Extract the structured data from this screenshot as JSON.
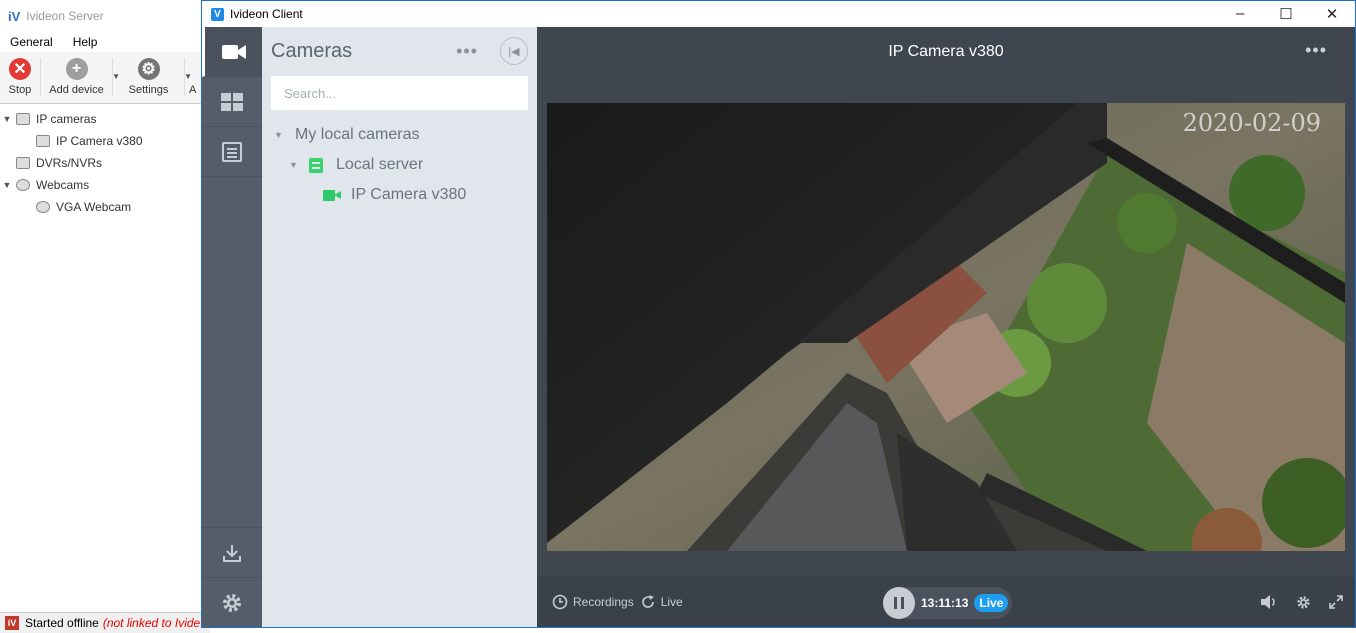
{
  "server": {
    "title": "Ivideon Server",
    "menu": [
      "General",
      "Help"
    ],
    "toolbar": {
      "stop": "Stop",
      "add_device": "Add device",
      "settings": "Settings",
      "cut": "A"
    },
    "tree": {
      "ip_cameras": "IP cameras",
      "ip_camera_v380": "IP Camera v380",
      "dvrs": "DVRs/NVRs",
      "webcams": "Webcams",
      "vga_webcam": "VGA Webcam"
    },
    "status": {
      "text": "Started offline",
      "note": "(not linked to Ivide"
    }
  },
  "client": {
    "title": "Ivideon Client",
    "panel": {
      "title": "Cameras",
      "search_placeholder": "Search...",
      "group": "My local cameras",
      "server": "Local server",
      "camera": "IP Camera v380"
    },
    "viewer": {
      "title": "IP Camera v380",
      "overlay_timestamp": "2020-02-09",
      "recordings_label": "Recordings",
      "live_label": "Live",
      "time": "13:11:13",
      "live_badge": "Live"
    }
  },
  "colors": {
    "accent": "#1e9ef0",
    "online": "#2ec968",
    "rail": "#545d69",
    "panel": "#e1e5ec",
    "viewer_bg": "#3f4650"
  }
}
